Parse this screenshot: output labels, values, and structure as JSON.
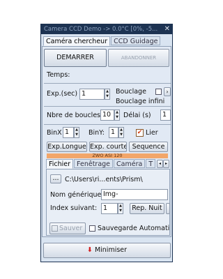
{
  "window": {
    "title": "Camera CCD Demo   -> 0.0°C  [0%, -5..."
  },
  "top_tabs": [
    "Caméra chercheur",
    "CCD Guidage"
  ],
  "buttons": {
    "start": "DEMARRER",
    "abort": "ABANDONNER"
  },
  "time_label": "Temps:",
  "exposure": {
    "label": "Exp.(sec)",
    "value": "1"
  },
  "looping": {
    "label": "Bouclage",
    "infinite_label": "Bouclage infini"
  },
  "loops": {
    "label": "Nbre de boucles",
    "value": "10"
  },
  "delay": {
    "label": "Délai (s)",
    "value": "1"
  },
  "binx": {
    "label": "BinX",
    "value": "1"
  },
  "biny": {
    "label": "BinY:",
    "value": "1"
  },
  "link": {
    "label": "Lier"
  },
  "exp_buttons": {
    "long": "Exp.Longue",
    "short": "Exp. courte",
    "sequence": "Sequence"
  },
  "camera_name": "ZWO ASI 120",
  "inner_tabs": [
    "Fichier",
    "Fenêtrage",
    "Caméra",
    "T"
  ],
  "browse_button": "...",
  "path": "C:\\Users\\ri...ents\\Prism\\",
  "generic_name": {
    "label": "Nom générique:",
    "value": "Img-"
  },
  "next_index": {
    "label": "Index suivant:",
    "value": "1"
  },
  "rep_nuit_button": "Rep. Nuit",
  "save_button": "Sauver",
  "auto_save": {
    "label": "Sauvegarde Automati"
  },
  "minimize_button": "Minimiser",
  "colors": {
    "title_bg": "#1d3352",
    "window_bg": "#d9e4f1",
    "minimize_icon": "#d42020",
    "camera_bar": "#f2a66a"
  }
}
